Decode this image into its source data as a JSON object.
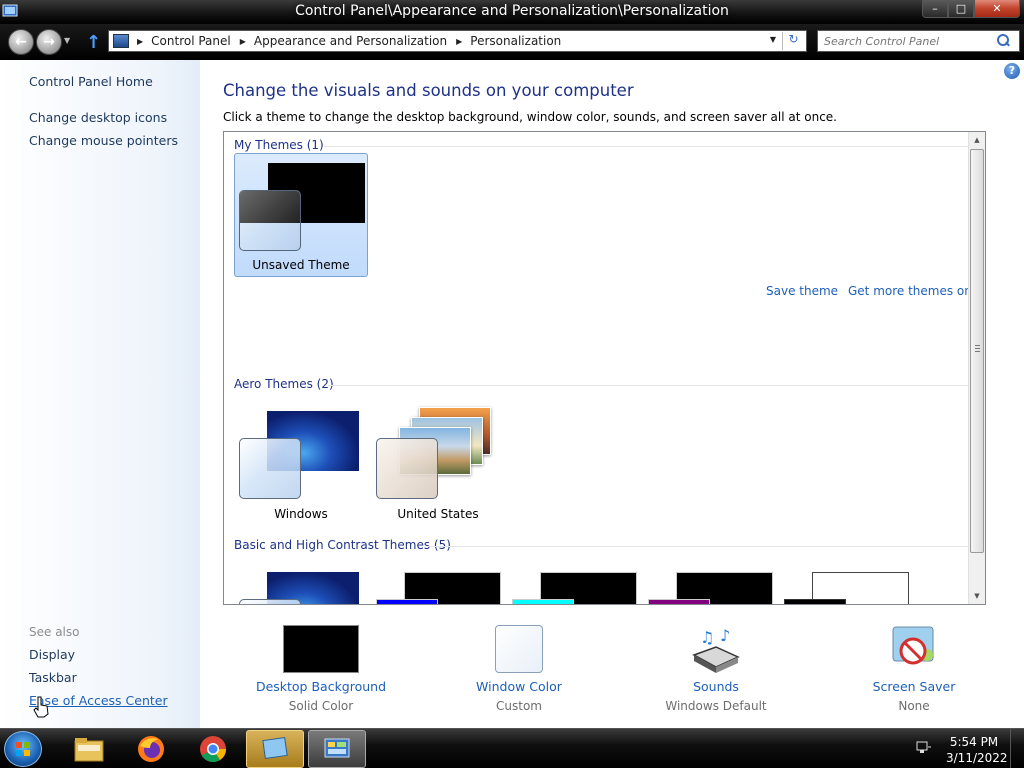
{
  "window": {
    "title": "Control Panel\\Appearance and Personalization\\Personalization",
    "minimize": "–",
    "maximize": "□",
    "close": "✕"
  },
  "address": {
    "crumbs": [
      "Control Panel",
      "Appearance and Personalization",
      "Personalization"
    ],
    "search_placeholder": "Search Control Panel"
  },
  "sidebar": {
    "home": "Control Panel Home",
    "links": [
      "Change desktop icons",
      "Change mouse pointers"
    ],
    "see_also_label": "See also",
    "see_also": [
      "Display",
      "Taskbar",
      "Ease of Access Center"
    ]
  },
  "main": {
    "heading": "Change the visuals and sounds on your computer",
    "subheading": "Click a theme to change the desktop background, window color, sounds, and screen saver all at once.",
    "groups": [
      {
        "title": "My Themes (1)",
        "themes": [
          "Unsaved Theme"
        ]
      },
      {
        "title": "Aero Themes (2)",
        "themes": [
          "Windows",
          "United States"
        ]
      },
      {
        "title": "Basic and High Contrast Themes (5)",
        "themes": []
      }
    ],
    "save_theme": "Save theme",
    "get_more": "Get more themes online",
    "help": "?"
  },
  "settings": [
    {
      "label": "Desktop Background",
      "value": "Solid Color"
    },
    {
      "label": "Window Color",
      "value": "Custom"
    },
    {
      "label": "Sounds",
      "value": "Windows Default"
    },
    {
      "label": "Screen Saver",
      "value": "None"
    }
  ],
  "taskbar": {
    "time": "5:54 PM",
    "date": "3/11/2022"
  },
  "colors": {
    "link": "#1e5fb8",
    "heading": "#1e3287",
    "selected_theme": "#c1dbfc"
  }
}
